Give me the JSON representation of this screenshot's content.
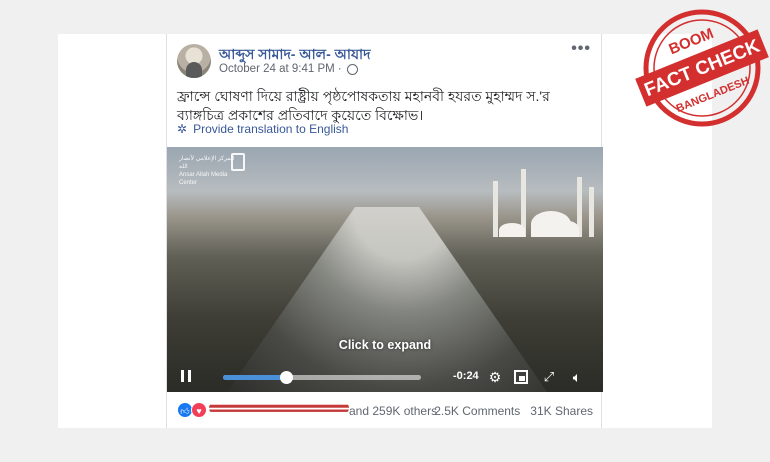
{
  "post": {
    "author": "আব্দুস সামাদ- আল- আযাদ",
    "timestamp": "October 24 at 9:41 PM",
    "separator": "·",
    "text": "ফ্রান্সে ঘোষণা দিয়ে রাষ্ট্রীয় পৃষ্ঠপোষকতায় মহানবী হযরত মুহাম্মদ স.'র ব্যাঙ্গচিত্র প্রকাশের প্রতিবাদে কুয়েতে বিক্ষোভ।",
    "translate_label": "Provide translation to English",
    "more_label": "•••",
    "icons": {
      "avatar": "profile-avatar",
      "privacy": "globe-icon",
      "translate": "gear-icon",
      "more": "more-options-icon"
    }
  },
  "video": {
    "logo_text": "المركز الإعلامي لأنصار الله\nAnsar Allah Media Center",
    "logo_mark": "ansar-allah-logo",
    "expand_label": "Click to expand",
    "time_remaining": "-0:24",
    "progress": 0.32,
    "controls": [
      "pause-icon",
      "settings-icon",
      "theater-mode-icon",
      "fullscreen-icon",
      "volume-icon"
    ]
  },
  "footer": {
    "reactions": [
      "like",
      "love"
    ],
    "others_text": "and 259K others",
    "comments": "2.5K Comments",
    "shares": "31K Shares"
  },
  "stamp": {
    "top": "BOOM",
    "main": "FACT CHECK",
    "bottom": "BANGLADESH",
    "color": "#d32f2f"
  },
  "colors": {
    "link": "#385898",
    "like": "#1877f2",
    "love": "#f33e58",
    "progress": "#4a90d9"
  }
}
